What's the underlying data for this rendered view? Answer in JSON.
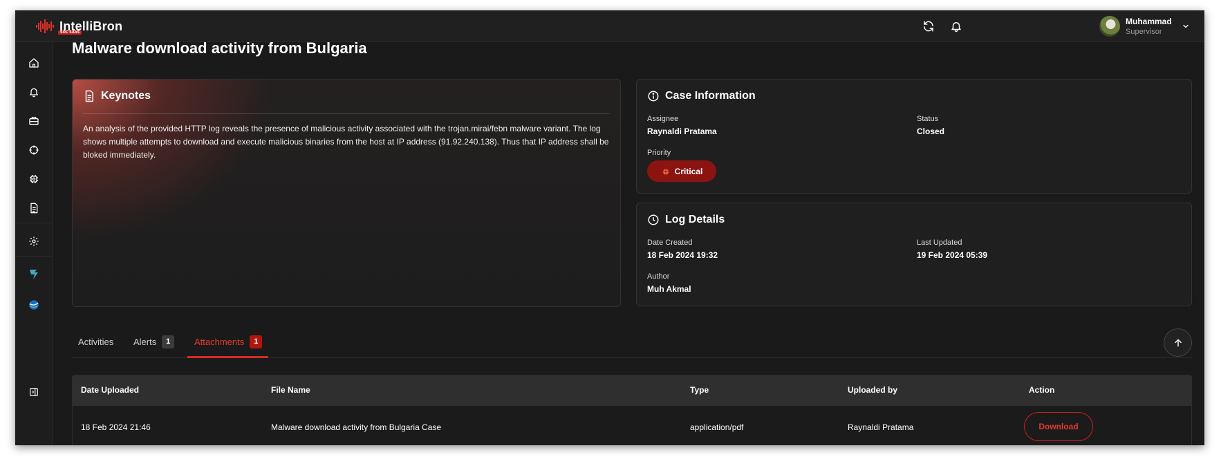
{
  "app": {
    "logo_text": "IntelliBron",
    "logo_tag": "SOC SAAS"
  },
  "user": {
    "name": "Muhammad",
    "role": "Supervisor"
  },
  "page": {
    "title": "Malware download activity from Bulgaria"
  },
  "keynotes": {
    "title": "Keynotes",
    "text": "An analysis of the provided HTTP log reveals the presence of malicious activity associated with the trojan.mirai/febn malware variant. The log shows multiple attempts to download and execute malicious binaries from the host at IP address (91.92.240.138). Thus that IP address shall be bloked immediately."
  },
  "case_info": {
    "title": "Case Information",
    "assignee_label": "Assignee",
    "assignee": "Raynaldi Pratama",
    "status_label": "Status",
    "status": "Closed",
    "priority_label": "Priority",
    "priority": "Critical"
  },
  "log_details": {
    "title": "Log Details",
    "date_created_label": "Date Created",
    "date_created": "18 Feb 2024 19:32",
    "last_updated_label": "Last Updated",
    "last_updated": "19 Feb 2024 05:39",
    "author_label": "Author",
    "author": "Muh Akmal"
  },
  "tabs": [
    {
      "label": "Activities",
      "count": ""
    },
    {
      "label": "Alerts",
      "count": "1"
    },
    {
      "label": "Attachments",
      "count": "1"
    }
  ],
  "table": {
    "headers": [
      "Date Uploaded",
      "File Name",
      "Type",
      "Uploaded by",
      "Action"
    ],
    "rows": [
      {
        "date_uploaded": "18 Feb 2024 21:46",
        "file_name": "Malware download activity from Bulgaria Case",
        "type": "application/pdf",
        "uploaded_by": "Raynaldi Pratama",
        "action": "Download"
      }
    ]
  },
  "colors": {
    "accent": "#d62a20",
    "background": "#1a1a1a",
    "critical_badge": "#8c1410"
  }
}
